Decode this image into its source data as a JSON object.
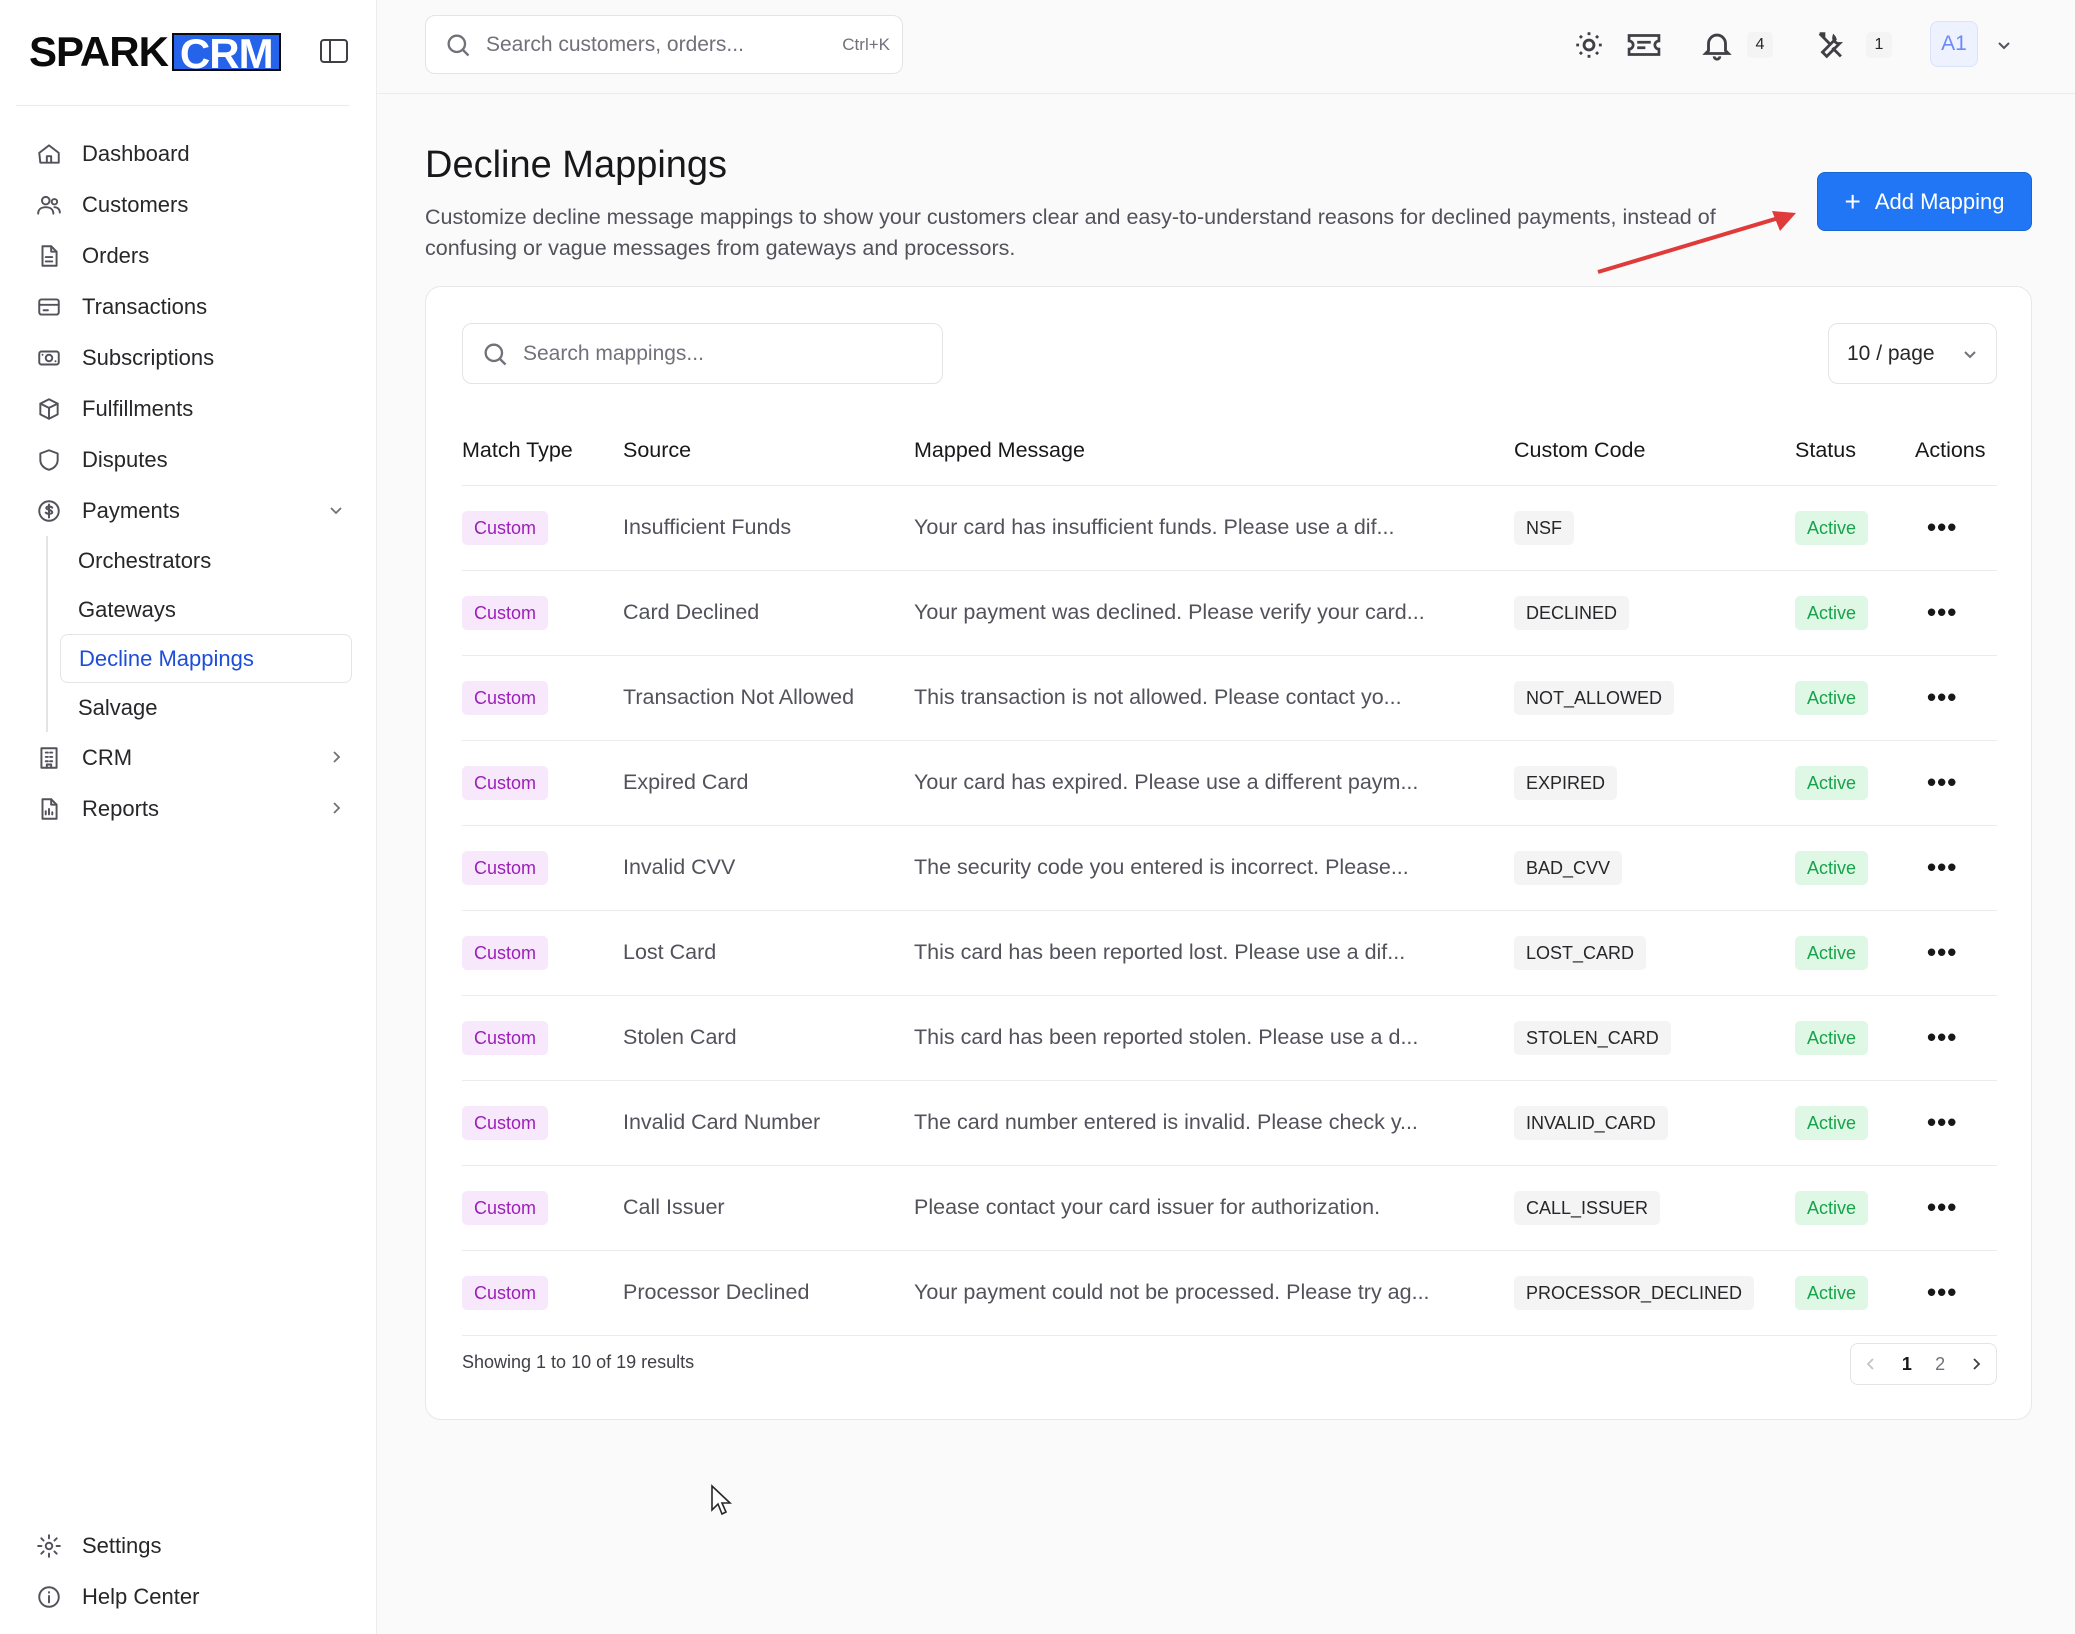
{
  "brand": {
    "spark": "SPARK",
    "crm": "CRM"
  },
  "sidebar": {
    "items": [
      {
        "label": "Dashboard",
        "icon": "home-icon"
      },
      {
        "label": "Customers",
        "icon": "users-icon"
      },
      {
        "label": "Orders",
        "icon": "file-icon"
      },
      {
        "label": "Transactions",
        "icon": "credit-card-icon"
      },
      {
        "label": "Subscriptions",
        "icon": "banknote-icon"
      },
      {
        "label": "Fulfillments",
        "icon": "package-icon"
      },
      {
        "label": "Disputes",
        "icon": "shield-icon"
      },
      {
        "label": "Payments",
        "icon": "dollar-circle-icon"
      }
    ],
    "payments_sub": [
      "Orchestrators",
      "Gateways",
      "Decline Mappings",
      "Salvage"
    ],
    "active_sub": "Decline Mappings",
    "after": [
      {
        "label": "CRM",
        "icon": "building-icon"
      },
      {
        "label": "Reports",
        "icon": "report-icon"
      }
    ],
    "bottom": [
      {
        "label": "Settings",
        "icon": "gear-icon"
      },
      {
        "label": "Help Center",
        "icon": "info-icon"
      }
    ]
  },
  "header": {
    "search_placeholder": "Search customers, orders...",
    "search_shortcut": "Ctrl+K",
    "notifications_count": "4",
    "tools_count": "1",
    "avatar_initials": "A1"
  },
  "page": {
    "title": "Decline Mappings",
    "description": "Customize decline message mappings to show your customers clear and easy-to-understand reasons for declined payments, instead of confusing or vague messages from gateways and processors.",
    "add_button": "Add Mapping"
  },
  "table": {
    "search_placeholder": "Search mappings...",
    "page_size": "10 / page",
    "columns": [
      "Match Type",
      "Source",
      "Mapped Message",
      "Custom Code",
      "Status",
      "Actions"
    ],
    "rows": [
      {
        "type": "Custom",
        "source": "Insufficient Funds",
        "message": "Your card has insufficient funds. Please use a dif...",
        "code": "NSF",
        "status": "Active"
      },
      {
        "type": "Custom",
        "source": "Card Declined",
        "message": "Your payment was declined. Please verify your card...",
        "code": "DECLINED",
        "status": "Active"
      },
      {
        "type": "Custom",
        "source": "Transaction Not Allowed",
        "message": "This transaction is not allowed. Please contact yo...",
        "code": "NOT_ALLOWED",
        "status": "Active"
      },
      {
        "type": "Custom",
        "source": "Expired Card",
        "message": "Your card has expired. Please use a different paym...",
        "code": "EXPIRED",
        "status": "Active"
      },
      {
        "type": "Custom",
        "source": "Invalid CVV",
        "message": "The security code you entered is incorrect. Please...",
        "code": "BAD_CVV",
        "status": "Active"
      },
      {
        "type": "Custom",
        "source": "Lost Card",
        "message": "This card has been reported lost. Please use a dif...",
        "code": "LOST_CARD",
        "status": "Active"
      },
      {
        "type": "Custom",
        "source": "Stolen Card",
        "message": "This card has been reported stolen. Please use a d...",
        "code": "STOLEN_CARD",
        "status": "Active"
      },
      {
        "type": "Custom",
        "source": "Invalid Card Number",
        "message": "The card number entered is invalid. Please check y...",
        "code": "INVALID_CARD",
        "status": "Active"
      },
      {
        "type": "Custom",
        "source": "Call Issuer",
        "message": "Please contact your card issuer for authorization.",
        "code": "CALL_ISSUER",
        "status": "Active"
      },
      {
        "type": "Custom",
        "source": "Processor Declined",
        "message": "Your payment could not be processed. Please try ag...",
        "code": "PROCESSOR_DECLINED",
        "status": "Active"
      }
    ],
    "actions_glyph": "•••",
    "showing": "Showing 1 to 10 of 19 results",
    "pages": [
      "1",
      "2"
    ],
    "current_page": "1"
  },
  "colors": {
    "accent": "#2076f5",
    "tag_purple": "#9b1fb8",
    "status_green": "#16a34a",
    "annotation_arrow": "#e03b3b"
  }
}
